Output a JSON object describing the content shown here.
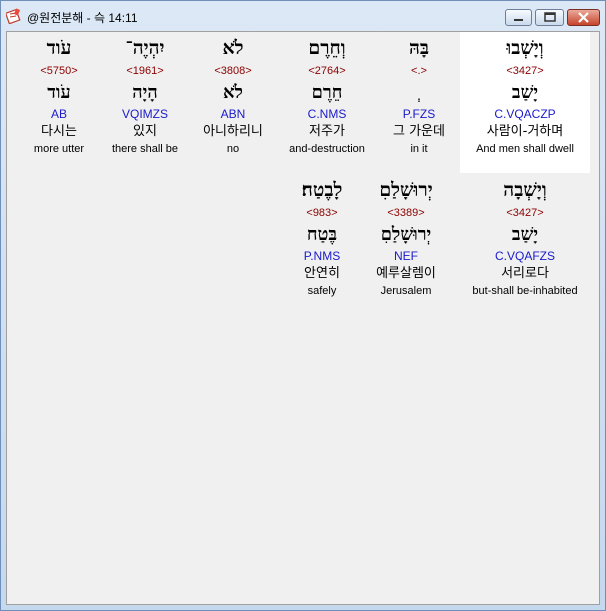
{
  "window": {
    "title": "@원전분해 - 슥 14:11"
  },
  "rows": [
    [
      {
        "heb": "עֹוד",
        "strong": "<5750>",
        "lemma": "עֹוד",
        "morph": "AB",
        "kor": "다시는",
        "eng": "more utter"
      },
      {
        "heb": "יִהְיֶה־",
        "strong": "<1961>",
        "lemma": "הָיָה",
        "morph": "VQIMZS",
        "kor": "있지",
        "eng": "there shall be"
      },
      {
        "heb": "לֹא",
        "strong": "<3808>",
        "lemma": "לֹא",
        "morph": "ABN",
        "kor": "아니하리니",
        "eng": "no"
      },
      {
        "heb": "וְחֵרֶם",
        "strong": "<2764>",
        "lemma": "חֵרֶם",
        "morph": "C.NMS",
        "kor": "저주가",
        "eng": "and-destruction"
      },
      {
        "heb": "בָּהּ",
        "strong": "<.>",
        "lemma": "ְ",
        "morph": "P.FZS",
        "kor": "그 가운데",
        "eng": "in it"
      },
      {
        "heb": "וְיָשְׁבוּ",
        "strong": "<3427>",
        "lemma": "יָשַׁב",
        "morph": "C.VQACZP",
        "kor": "사람이-거하며",
        "eng": "And men shall dwell"
      }
    ],
    [
      {
        "heb": "לָבֶטַח׃",
        "strong": "<983>",
        "lemma": "בֶּטַח",
        "morph": "P.NMS",
        "kor": "안연히",
        "eng": "safely"
      },
      {
        "heb": "יְרוּשָׁלַםִ",
        "strong": "<3389>",
        "lemma": "יְרוּשָׁלַםִ",
        "morph": "NEF",
        "kor": "예루살렘이",
        "eng": "Jerusalem"
      },
      {
        "heb": "וְיָשְׁבָה",
        "strong": "<3427>",
        "lemma": "יָשַׁב",
        "morph": "C.VQAFZS",
        "kor": "서리로다",
        "eng": "but-shall be-inhabited"
      }
    ]
  ]
}
